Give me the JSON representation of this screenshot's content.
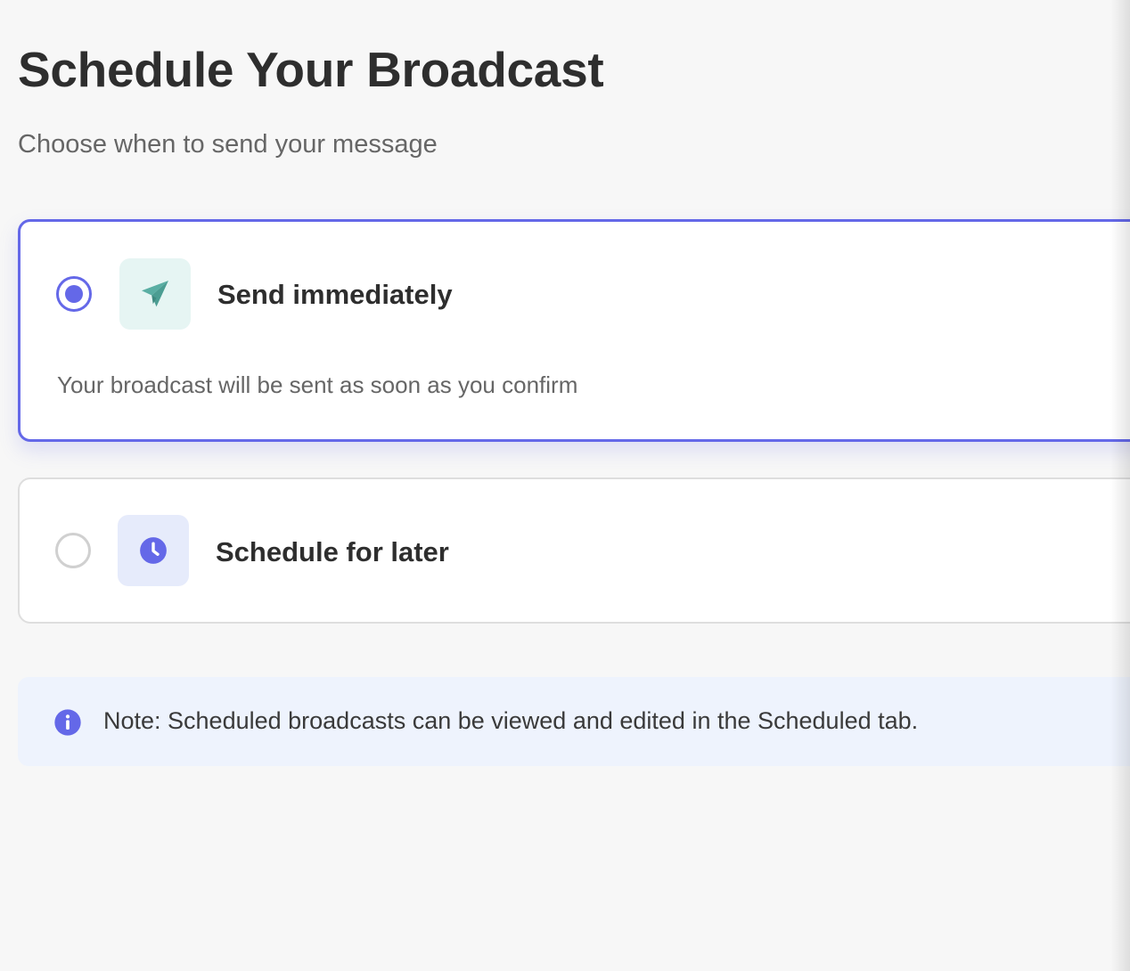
{
  "header": {
    "title": "Schedule Your Broadcast",
    "subtitle": "Choose when to send your message"
  },
  "options": [
    {
      "label": "Send immediately",
      "description": "Your broadcast will be sent as soon as you confirm",
      "selected": true,
      "icon": "paper-plane-icon"
    },
    {
      "label": "Schedule for later",
      "selected": false,
      "icon": "clock-icon"
    }
  ],
  "note": {
    "text": "Note: Scheduled broadcasts can be viewed and edited in the Scheduled tab.",
    "icon": "info-icon"
  },
  "colors": {
    "accent": "#6468e8",
    "teal": "#5aaea3",
    "page_background": "#f7f7f7",
    "note_background": "#eef3fd"
  }
}
